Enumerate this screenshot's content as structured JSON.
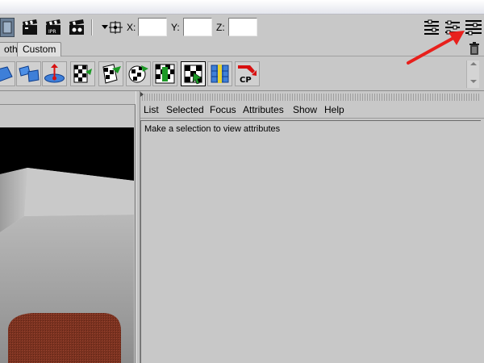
{
  "status_line": {
    "coords": {
      "x_label": "X:",
      "y_label": "Y:",
      "z_label": "Z:",
      "x_value": "",
      "y_value": "",
      "z_value": ""
    }
  },
  "shelf_tabs": [
    {
      "label": "oth"
    },
    {
      "label": "Custom"
    }
  ],
  "shelf_icons": [
    {
      "name": "plane-map-icon"
    },
    {
      "name": "uv-layout-icon"
    },
    {
      "name": "cylindrical-map-icon"
    },
    {
      "name": "checker-move-icon"
    },
    {
      "name": "checker-cut-icon"
    },
    {
      "name": "checker-sew-icon"
    },
    {
      "name": "checker-unfold-icon"
    },
    {
      "name": "uv-editor-icon"
    },
    {
      "name": "uv-align-icon"
    },
    {
      "name": "cp-snapshot-icon",
      "label": "CP"
    }
  ],
  "attribute_editor": {
    "menu": [
      "List",
      "Selected",
      "Focus",
      "Attributes",
      "Show",
      "Help"
    ],
    "message": "Make a selection to view attributes"
  },
  "colors": {
    "ui_gray": "#c8c8c8",
    "annotation_arrow": "#e8201c",
    "viewport_bg": "#000000"
  }
}
